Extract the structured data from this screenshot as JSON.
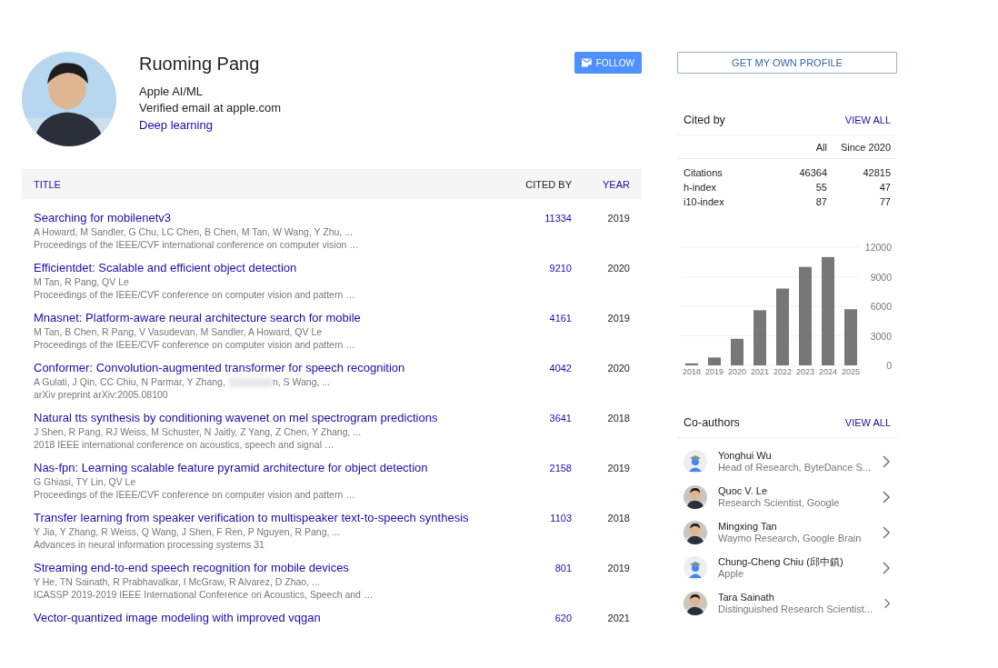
{
  "profile": {
    "name": "Ruoming Pang",
    "affiliation": "Apple AI/ML",
    "email": "Verified email at apple.com",
    "interests": [
      "Deep learning"
    ],
    "avatar": {
      "kind": "picture"
    }
  },
  "follow_button": {
    "label": "FOLLOW"
  },
  "get_profile_button": {
    "label": "GET MY OWN PROFILE"
  },
  "table": {
    "columns": [
      {
        "label": "TITLE",
        "selected": false
      },
      {
        "label": "CITED BY",
        "selected": true
      },
      {
        "label": "YEAR",
        "selected": false
      }
    ],
    "rows": [
      {
        "title": "Searching for mobilenetv3",
        "authors": "A Howard, M Sandler, G Chu, LC Chen, B Chen, M Tan, W Wang, Y Zhu, ...",
        "venue": "Proceedings of the IEEE/CVF international conference on computer vision …",
        "cited_by": "11334",
        "year": "2019"
      },
      {
        "title": "Efficientdet: Scalable and efficient object detection",
        "authors": "M Tan, R Pang, QV Le",
        "venue": "Proceedings of the IEEE/CVF conference on computer vision and pattern …",
        "cited_by": "9210",
        "year": "2020"
      },
      {
        "title": "Mnasnet: Platform-aware neural architecture search for mobile",
        "authors": "M Tan, B Chen, R Pang, V Vasudevan, M Sandler, A Howard, QV Le",
        "venue": "Proceedings of the IEEE/CVF conference on computer vision and pattern …",
        "cited_by": "4161",
        "year": "2019"
      },
      {
        "title": "Conformer: Convolution-augmented transformer for speech recognition",
        "authors": "A Gulati, J Qin, CC Chiu, N Parmar, Y Zhang,",
        "redacted": true,
        "authors_tail": "n, S Wang, ...",
        "venue": "arXiv preprint arXiv:2005.08100",
        "cited_by": "4042",
        "year": "2020"
      },
      {
        "title": "Natural tts synthesis by conditioning wavenet on mel spectrogram predictions",
        "authors": "J Shen, R Pang, RJ Weiss, M Schuster, N Jaitly, Z Yang, Z Chen, Y Zhang, ...",
        "venue": "2018 IEEE international conference on acoustics, speech and signal …",
        "cited_by": "3641",
        "year": "2018"
      },
      {
        "title": "Nas-fpn: Learning scalable feature pyramid architecture for object detection",
        "authors": "G Ghiasi, TY Lin, QV Le",
        "venue": "Proceedings of the IEEE/CVF conference on computer vision and pattern …",
        "cited_by": "2158",
        "year": "2019"
      },
      {
        "title": "Transfer learning from speaker verification to multispeaker text-to-speech synthesis",
        "authors": "Y Jia, Y Zhang, R Weiss, Q Wang, J Shen, F Ren, P Nguyen, R Pang, ...",
        "venue": "Advances in neural information processing systems 31",
        "cited_by": "1103",
        "year": "2018"
      },
      {
        "title": "Streaming end-to-end speech recognition for mobile devices",
        "authors": "Y He, TN Sainath, R Prabhavalkar, I McGraw, R Alvarez, D Zhao, ...",
        "venue": "ICASSP 2019-2019 IEEE International Conference on Acoustics, Speech and …",
        "cited_by": "801",
        "year": "2019"
      },
      {
        "title": "Vector-quantized image modeling with improved vqgan",
        "cited_by": "620",
        "year": "2021"
      }
    ]
  },
  "cited_by": {
    "title": "Cited by",
    "view_all": "VIEW ALL",
    "columns": [
      "All",
      "Since 2020"
    ],
    "rows": [
      {
        "label": "Citations",
        "all": "46364",
        "since": "42815"
      },
      {
        "label": "h-index",
        "all": "55",
        "since": "47"
      },
      {
        "label": "i10-index",
        "all": "87",
        "since": "77"
      }
    ],
    "chart_data": {
      "type": "bar",
      "categories": [
        "2018",
        "2019",
        "2020",
        "2021",
        "2022",
        "2023",
        "2024",
        "2025"
      ],
      "values": [
        200,
        800,
        2700,
        5600,
        7800,
        10000,
        11000,
        5700
      ],
      "ylim": [
        0,
        12000
      ],
      "yticks": [
        0,
        3000,
        6000,
        9000,
        12000
      ],
      "grid": true
    }
  },
  "coauthors": {
    "title": "Co-authors",
    "view_all": "VIEW ALL",
    "items": [
      {
        "name": "Yonghui Wu",
        "affiliation": "Head of Research, ByteDance S...",
        "kind": "default"
      },
      {
        "name": "Quoc V. Le",
        "affiliation": "Research Scientist, Google"
      },
      {
        "name": "Mingxing Tan",
        "affiliation": "Waymo Research, Google Brain"
      },
      {
        "name": "Chung-Cheng Chiu (邱中鎮)",
        "affiliation": "Apple",
        "kind": "default"
      },
      {
        "name": "Tara Sainath",
        "affiliation": "Distinguished Research Scientist..."
      }
    ]
  }
}
